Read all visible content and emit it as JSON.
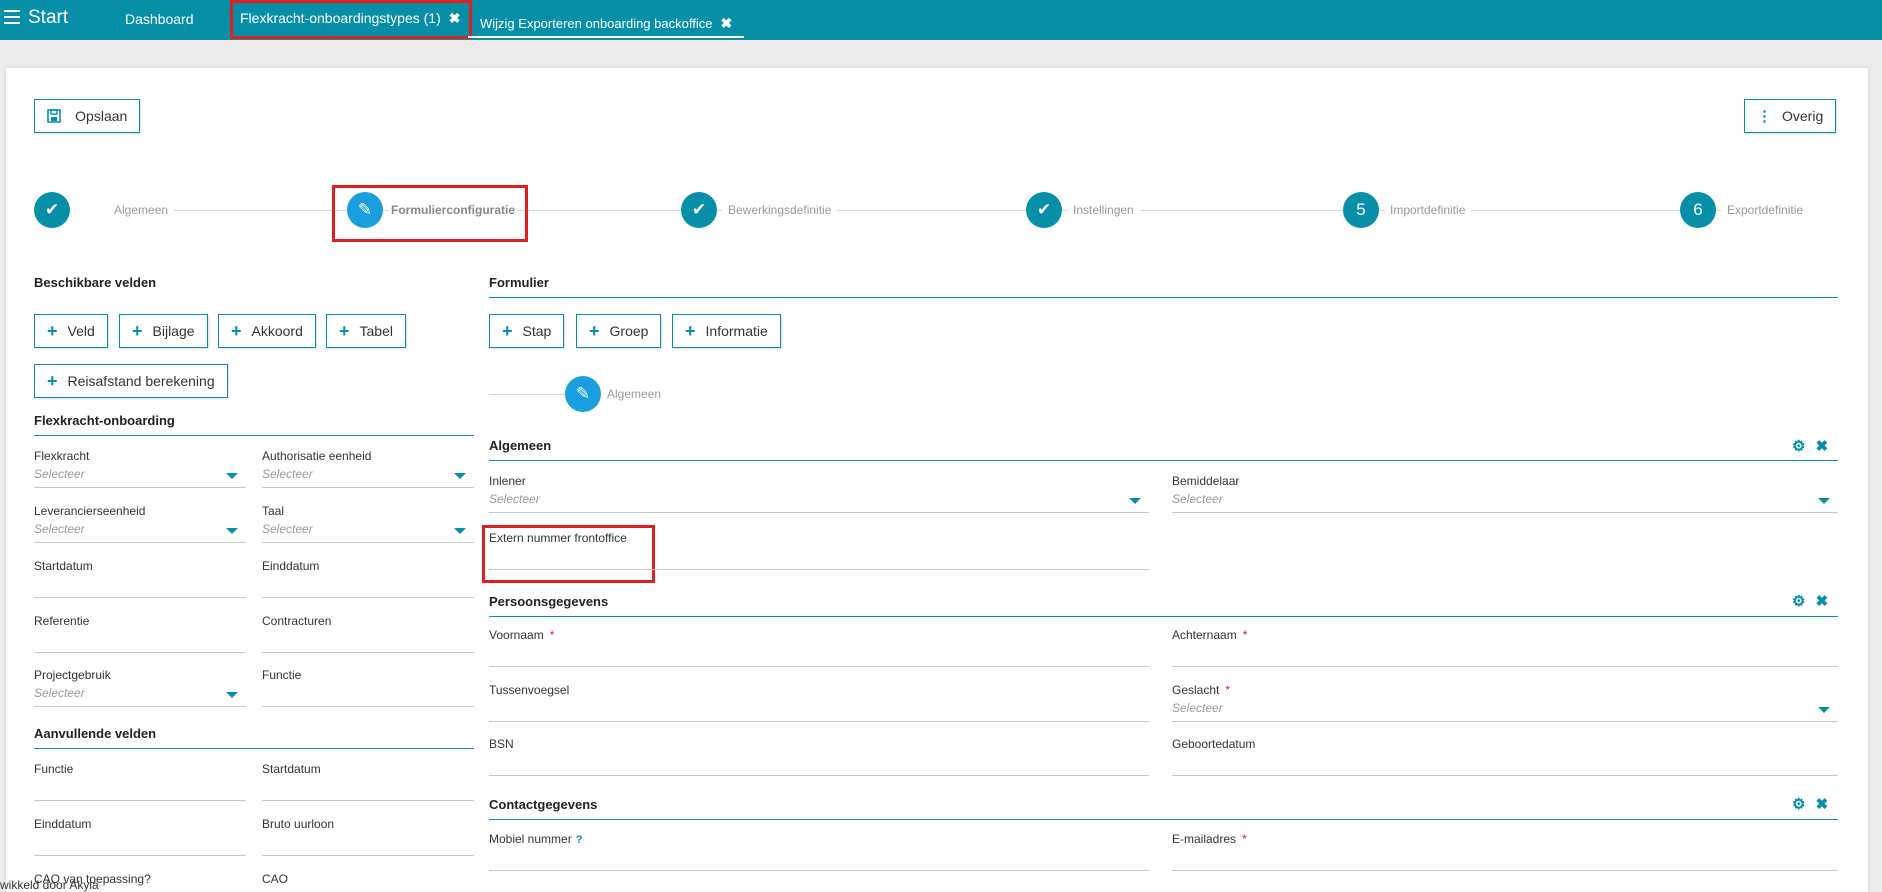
{
  "topbar": {
    "start": "Start",
    "dashboard": "Dashboard",
    "tabs": [
      {
        "label": "Flexkracht-onboardingstypes (1)"
      },
      {
        "label": "Wijzig Exporteren onboarding backoffice"
      }
    ],
    "close_glyph": "✖"
  },
  "toolbar": {
    "save_label": "Opslaan",
    "more_label": "Overig"
  },
  "stepper": {
    "steps": [
      {
        "label": "Algemeen",
        "marker": "✔"
      },
      {
        "label": "Formulierconfiguratie",
        "marker": "✎"
      },
      {
        "label": "Bewerkingsdefinitie",
        "marker": "✔"
      },
      {
        "label": "Instellingen",
        "marker": "✔"
      },
      {
        "label": "Importdefinitie",
        "marker": "5"
      },
      {
        "label": "Exportdefinitie",
        "marker": "6"
      }
    ],
    "current_step": 2
  },
  "available": {
    "title": "Beschikbare velden",
    "buttons": [
      "Veld",
      "Bijlage",
      "Akkoord",
      "Tabel",
      "Reisafstand berekening"
    ],
    "groups": [
      {
        "title": "Flexkracht-onboarding",
        "fields": [
          {
            "label": "Flexkracht",
            "placeholder": "Selecteer"
          },
          {
            "label": "Authorisatie eenheid",
            "placeholder": "Selecteer"
          },
          {
            "label": "Leverancierseenheid",
            "placeholder": "Selecteer"
          },
          {
            "label": "Taal",
            "placeholder": "Selecteer"
          },
          {
            "label": "Startdatum"
          },
          {
            "label": "Einddatum"
          },
          {
            "label": "Referentie"
          },
          {
            "label": "Contracturen"
          },
          {
            "label": "Projectgebruik",
            "placeholder": "Selecteer"
          },
          {
            "label": "Functie"
          }
        ]
      },
      {
        "title": "Aanvullende velden",
        "fields": [
          {
            "label": "Functie"
          },
          {
            "label": "Startdatum"
          },
          {
            "label": "Einddatum"
          },
          {
            "label": "Bruto uurloon"
          },
          {
            "label": "CAO van toepassing?"
          },
          {
            "label": "CAO"
          }
        ]
      }
    ]
  },
  "form": {
    "title": "Formulier",
    "buttons": [
      "Stap",
      "Groep",
      "Informatie"
    ],
    "substep": {
      "label": "Algemeen",
      "marker": "✎"
    },
    "sections": [
      {
        "title": "Algemeen",
        "fields": [
          {
            "label": "Inlener",
            "placeholder": "Selecteer"
          },
          {
            "label": "Bemiddelaar",
            "placeholder": "Selecteer"
          },
          {
            "label": "Extern nummer frontoffice"
          }
        ]
      },
      {
        "title": "Persoonsgegevens",
        "fields": [
          {
            "label": "Voornaam",
            "required": "*"
          },
          {
            "label": "Achternaam",
            "required": "*"
          },
          {
            "label": "Tussenvoegsel"
          },
          {
            "label": "Geslacht",
            "required": "*",
            "placeholder": "Selecteer"
          },
          {
            "label": "BSN"
          },
          {
            "label": "Geboortedatum"
          }
        ]
      },
      {
        "title": "Contactgegevens",
        "fields": [
          {
            "label": "Mobiel nummer",
            "help": "?"
          },
          {
            "label": "E-mailadres",
            "required": "*"
          }
        ]
      }
    ],
    "section_tools": {
      "settings": "⚙",
      "close": "✖"
    }
  },
  "footer": {
    "text": "wikkeld door Akyla"
  },
  "colors": {
    "accent": "#078fa8",
    "active_step": "#1a9fde",
    "highlight": "#e02020"
  }
}
